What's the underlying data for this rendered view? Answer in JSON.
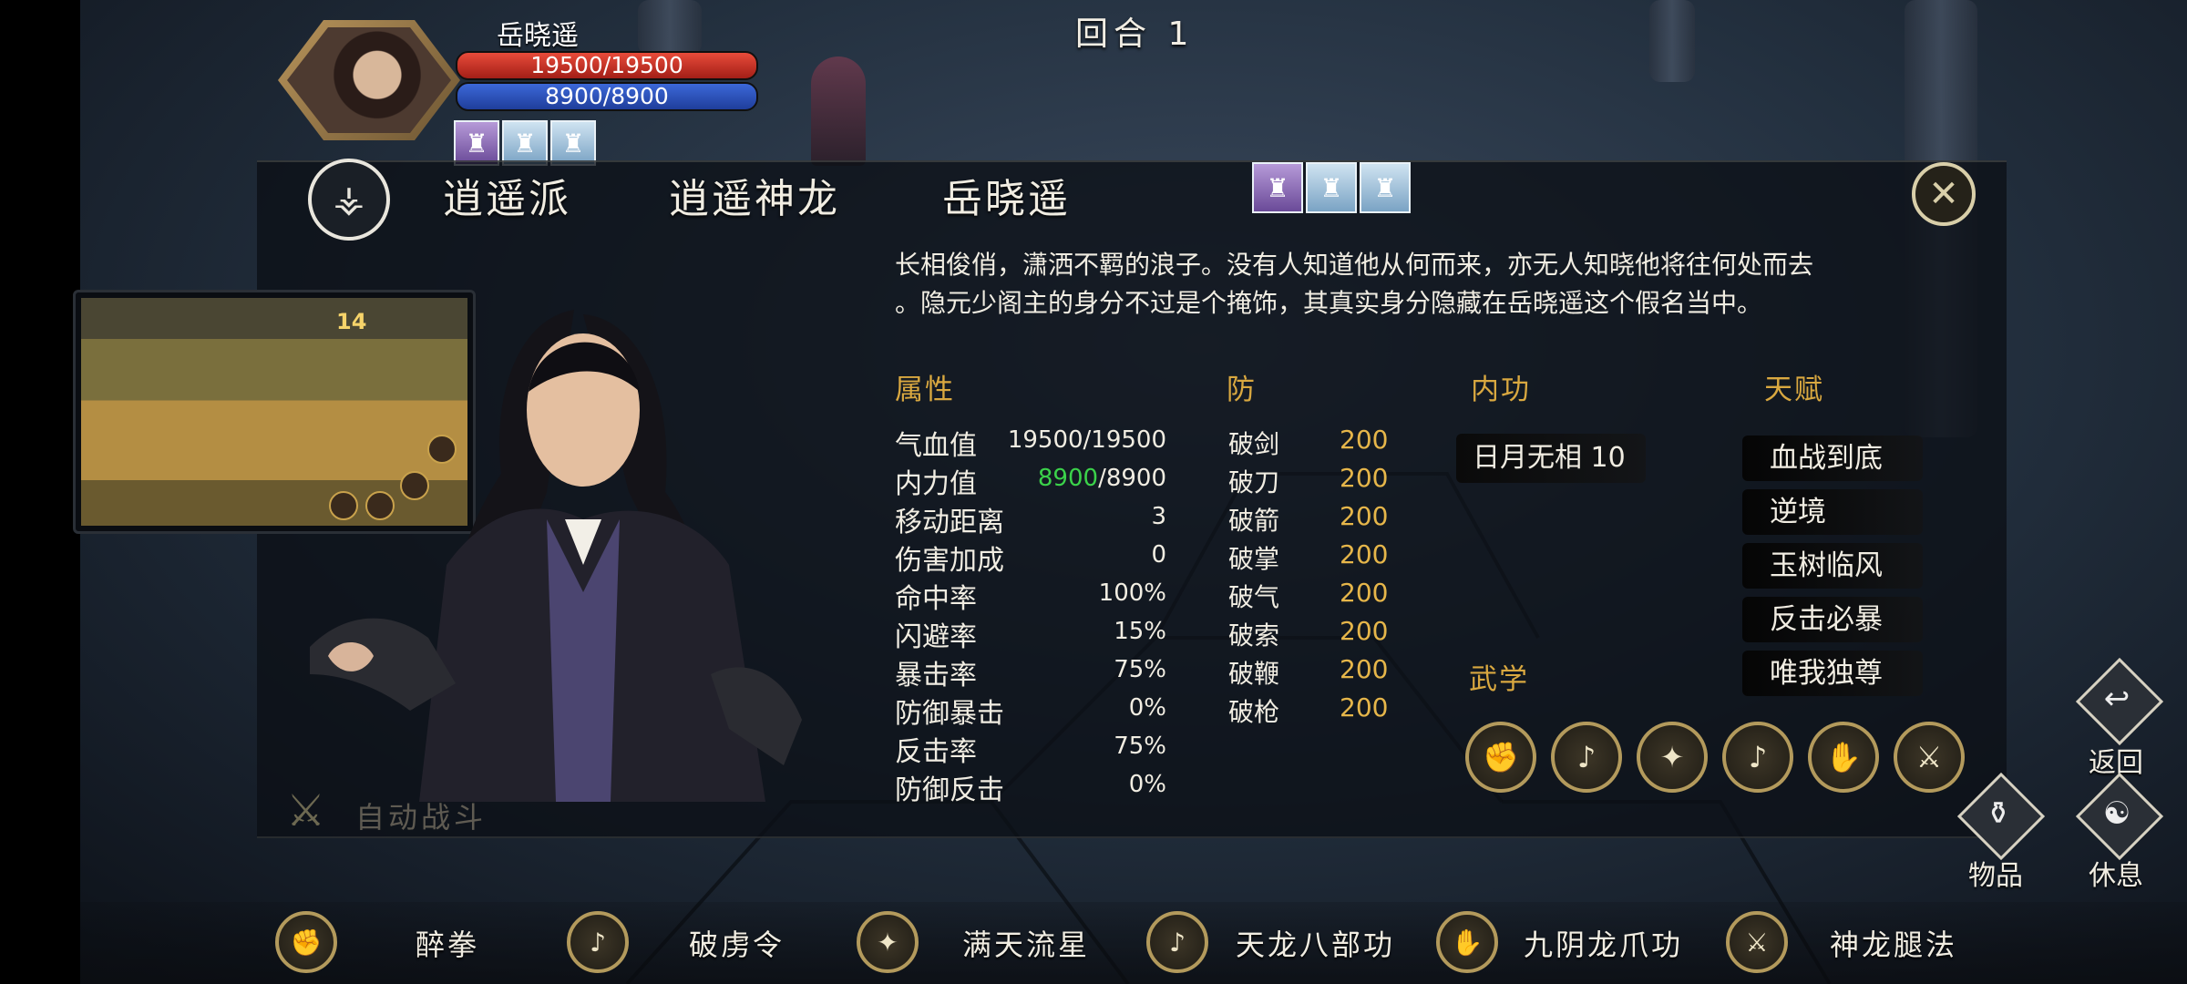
{
  "round_label": "回合 1",
  "unit": {
    "name": "岳晓遥",
    "hp": "19500/19500",
    "mp": "8900/8900",
    "buffs": [
      "buff-icon-1",
      "buff-icon-2",
      "buff-icon-3"
    ]
  },
  "header": {
    "sect": "逍遥派",
    "title": "逍遥神龙",
    "name": "岳晓遥",
    "buffs": [
      "buff-icon-1",
      "buff-icon-2",
      "buff-icon-3"
    ],
    "close_icon": "close-icon"
  },
  "description_line1": "长相俊俏，潇洒不羁的浪子。没有人知道他从何而来，亦无人知晓他将往何处而去",
  "description_line2": "。隐元少阁主的身分不过是个掩饰，其真实身分隐藏在岳晓遥这个假名当中。",
  "minimap": {
    "round_number": "14"
  },
  "attributes": {
    "title": "属性",
    "rows": [
      {
        "label": "气血值",
        "value": "19500/19500"
      },
      {
        "label": "内力值",
        "value_current": "8900",
        "value_max": "/8900"
      },
      {
        "label": "移动距离",
        "value": "3"
      },
      {
        "label": "伤害加成",
        "value": "0"
      },
      {
        "label": "命中率",
        "value": "100%"
      },
      {
        "label": "闪避率",
        "value": "15%"
      },
      {
        "label": "暴击率",
        "value": "75%"
      },
      {
        "label": "防御暴击",
        "value": "0%"
      },
      {
        "label": "反击率",
        "value": "75%"
      },
      {
        "label": "防御反击",
        "value": "0%"
      }
    ]
  },
  "defense": {
    "title": "防",
    "rows": [
      {
        "label": "破剑",
        "value": "200"
      },
      {
        "label": "破刀",
        "value": "200"
      },
      {
        "label": "破箭",
        "value": "200"
      },
      {
        "label": "破掌",
        "value": "200"
      },
      {
        "label": "破气",
        "value": "200"
      },
      {
        "label": "破索",
        "value": "200"
      },
      {
        "label": "破鞭",
        "value": "200"
      },
      {
        "label": "破枪",
        "value": "200"
      }
    ]
  },
  "inner_skill": {
    "title": "内功",
    "entry": "日月无相 10"
  },
  "talents": {
    "title": "天赋",
    "items": [
      "血战到底",
      "逆境",
      "玉树临风",
      "反击必暴",
      "唯我独尊"
    ]
  },
  "martial": {
    "title": "武学",
    "icons": [
      "fist-icon",
      "lute-icon",
      "shuriken-icon",
      "lute-icon",
      "claw-icon",
      "kick-icon"
    ]
  },
  "auto_battle": "自动战斗",
  "side": {
    "back": "返回",
    "items": "物品",
    "rest": "休息"
  },
  "bottom_skills": [
    {
      "label": "醉拳",
      "icon": "fist-icon"
    },
    {
      "label": "破虏令",
      "icon": "lute-icon"
    },
    {
      "label": "满天流星",
      "icon": "shuriken-icon"
    },
    {
      "label": "天龙八部功",
      "icon": "lute-icon"
    },
    {
      "label": "九阴龙爪功",
      "icon": "claw-icon"
    },
    {
      "label": "神龙腿法",
      "icon": "kick-icon"
    }
  ],
  "colors": {
    "accent_gold": "#d9a840",
    "value_gold": "#e6b64a",
    "hp_red": "#e84b3a",
    "mp_blue": "#3c68d8",
    "mp_green": "#3bd24a"
  }
}
